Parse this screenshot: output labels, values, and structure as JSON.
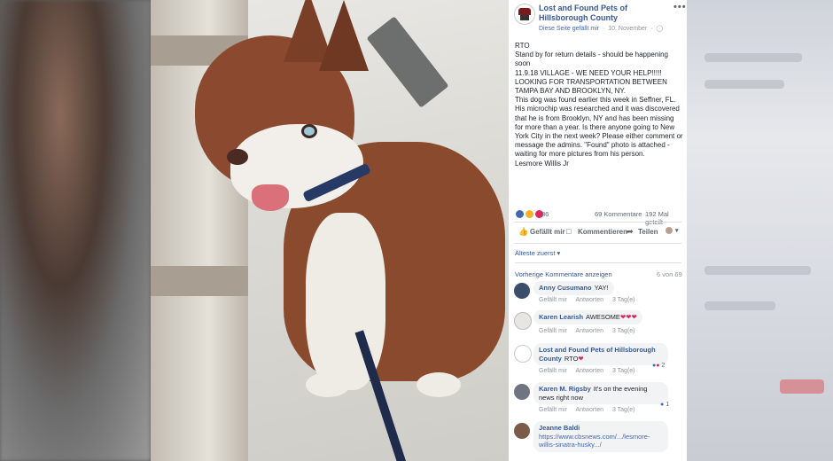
{
  "post": {
    "page_name": "Lost and Found Pets of Hillsborough County",
    "liked_page": "Diese Seite gefällt mir",
    "date": "10. November",
    "more_icon": "more-icon",
    "body": [
      "RTO",
      "Stand by for return details - should be happening soon",
      "11.9.18 VILLAGE - WE NEED YOUR HELP!!!!!",
      "LOOKING FOR TRANSPORTATION BETWEEN TAMPA BAY AND BROOKLYN, NY.",
      "This dog was found earlier this week in Seffner, FL. His microchip was researched and it was discovered that he is from Brooklyn, NY and has been missing for more than a year. Is there anyone going to New York City in the next week? Please either comment or message the admins. \"Found\" photo is attached - waiting for more pictures from his person.",
      "Lesmore Willis Jr"
    ]
  },
  "stats": {
    "reactions": "86",
    "comments": "69 Kommentare",
    "shares": "192 Mal geteilt"
  },
  "actions": {
    "like": "Gefällt mir",
    "comment": "Kommentieren",
    "share": "Teilen"
  },
  "comments_section": {
    "sort": "Älteste zuerst ▾",
    "previous": "Vorherige Kommentare anzeigen",
    "count": "6 von 69",
    "like_label": "Gefällt mir",
    "reply_label": "Antworten",
    "items": [
      {
        "name": "Anny Cusumano",
        "text": "YAY!",
        "time": "3 Tag(e)"
      },
      {
        "name": "Karen Learish",
        "text": "AWESOME",
        "time": "3 Tag(e)"
      },
      {
        "name": "Lost and Found Pets of Hillsborough County",
        "text": "RTO",
        "time": "3 Tag(e)",
        "reacts": "2"
      },
      {
        "name": "Karen M. Rigsby",
        "text": "It's on the evening news right now",
        "time": "3 Tag(e)",
        "reacts": "1"
      },
      {
        "name": "Jeanne Baldi",
        "text": "https://www.cbsnews.com/.../lesmore-willis-sinatra-husky.../"
      }
    ]
  },
  "colors": {
    "link_blue": "#365899",
    "heart": "#e0245e",
    "like_blue": "#4267b2"
  }
}
